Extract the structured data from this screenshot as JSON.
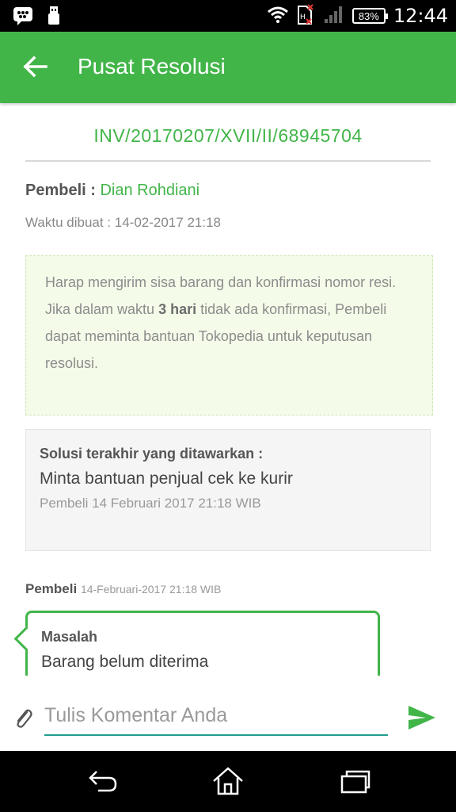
{
  "status_bar": {
    "battery": "83%",
    "time": "12:44",
    "icons": [
      "bbm-icon",
      "usb-icon",
      "wifi-icon",
      "sim-error-icon",
      "signal-icon",
      "battery-icon"
    ]
  },
  "app_bar": {
    "title": "Pusat Resolusi",
    "back_icon": "arrow-left-icon"
  },
  "detail": {
    "invoice": "INV/20170207/XVII/II/68945704",
    "buyer_label": "Pembeli :",
    "buyer_name": "Dian Rohdiani",
    "created": "Waktu dibuat : 14-02-2017 21:18"
  },
  "notice": {
    "line1": "Harap mengirim sisa barang dan konfirmasi nomor resi.",
    "line2_prefix": "Jika dalam waktu ",
    "line2_bold": "3 hari",
    "line2_suffix": " tidak ada konfirmasi, Pembeli dapat meminta bantuan Tokopedia untuk keputusan resolusi."
  },
  "solution": {
    "label": "Solusi terakhir yang ditawarkan :",
    "value": "Minta bantuan penjual cek ke kurir",
    "meta": "Pembeli 14 Februari 2017 21:18 WIB"
  },
  "message": {
    "sender": "Pembeli",
    "timestamp": "14-Februari-2017 21:18 WIB",
    "title": "Masalah",
    "body": "Barang belum diterima"
  },
  "composer": {
    "placeholder": "Tulis Komentar Anda",
    "value": ""
  },
  "nav_bar": {
    "buttons": [
      "back-nav-icon",
      "home-nav-icon",
      "recents-nav-icon"
    ]
  },
  "colors": {
    "primary": "#42b549",
    "accent_underline": "#1f9e8c",
    "notice_bg": "#f4fbe9"
  }
}
